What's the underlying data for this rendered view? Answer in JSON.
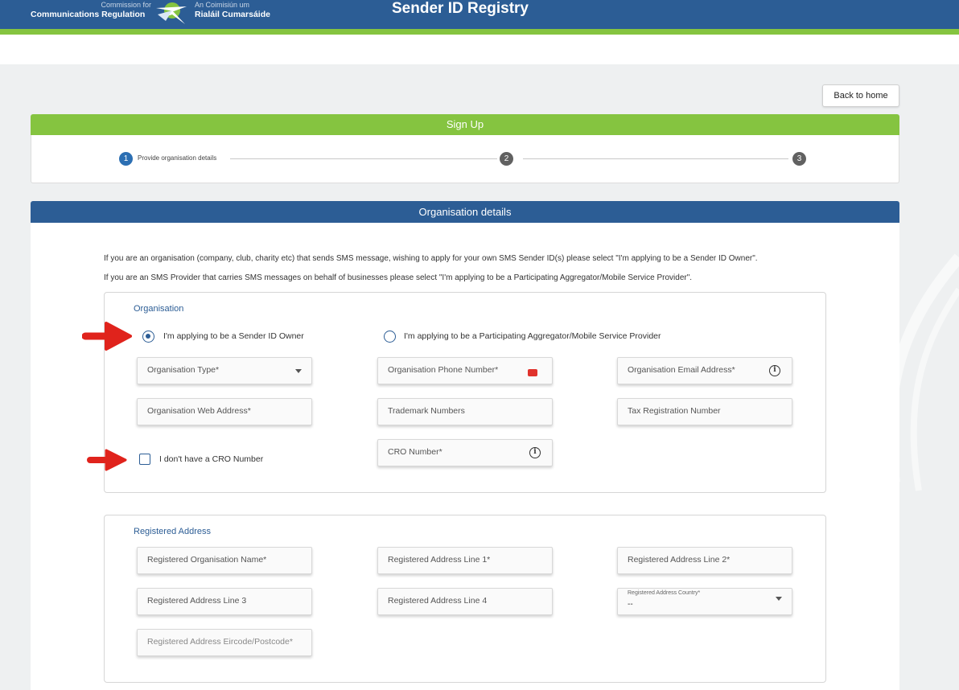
{
  "header": {
    "org_en_small": "Commission for",
    "org_en_big": "Communications Regulation",
    "org_ga_small": "An Coimisiún um",
    "org_ga_big": "Rialáil Cumarsáide",
    "site_title": "Sender ID Registry",
    "logo_icon": "comreg-logo-icon"
  },
  "back_button": "Back to home",
  "signup": {
    "title": "Sign Up",
    "steps": [
      {
        "number": "1",
        "label": "Provide organisation details",
        "active": true
      },
      {
        "number": "2",
        "label": "",
        "active": false
      },
      {
        "number": "3",
        "label": "",
        "active": false
      }
    ]
  },
  "org_details": {
    "title": "Organisation details",
    "intro_1": "If you are an organisation (company, club, charity etc) that sends SMS message, wishing to apply for your own SMS Sender ID(s) please select \"I'm applying to be a Sender ID Owner\".",
    "intro_2": "If you are an SMS Provider that carries SMS messages on behalf of businesses please select \"I'm applying to be a Participating Aggregator/Mobile Service Provider\".",
    "organisation": {
      "title": "Organisation",
      "radio_owner": "I'm applying to be a Sender ID Owner",
      "radio_aggregator": "I'm applying to be a Participating Aggregator/Mobile Service Provider",
      "selected": "owner",
      "org_type": "Organisation Type*",
      "phone": "Organisation Phone Number*",
      "email": "Organisation Email Address*",
      "web": "Organisation Web Address*",
      "trademark": "Trademark Numbers",
      "tax": "Tax Registration Number",
      "no_cro": "I don't have a CRO Number",
      "cro": "CRO Number*"
    },
    "address": {
      "title": "Registered Address",
      "org_name": "Registered Organisation Name*",
      "line1": "Registered Address Line 1*",
      "line2": "Registered Address Line 2*",
      "line3": "Registered Address Line 3",
      "line4": "Registered Address Line 4",
      "country_label": "Registered Address Country*",
      "country_value": "--",
      "eircode": "Registered Address Eircode/Postcode*"
    }
  },
  "colors": {
    "brand_blue": "#2c5d95",
    "brand_green": "#85c440",
    "annotation_red": "#e0231c"
  }
}
